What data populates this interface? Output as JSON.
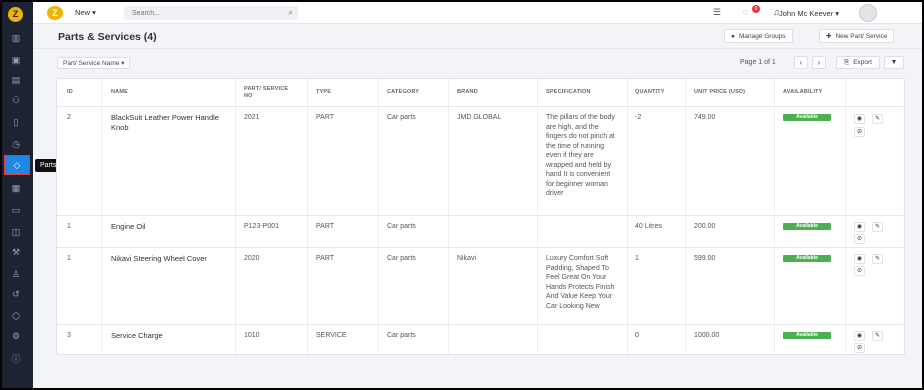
{
  "sidebar": {
    "logo_letter": "Z",
    "icons": [
      "dashboard-icon",
      "calendar-icon",
      "inventory-icon",
      "customers-icon",
      "map-icon",
      "history-icon",
      "parts-services-icon",
      "reports-icon",
      "folder-icon",
      "cube-icon",
      "tools-icon",
      "user-icon",
      "refresh-icon",
      "settings-icon",
      "gear-icon",
      "help-icon"
    ],
    "tooltip": "Parts & Services"
  },
  "topbar": {
    "logo_letter": "Z",
    "new_label": "New ▾",
    "search_placeholder": "Search...",
    "notification_count": "0",
    "user_name": "John Mc Keever ▾"
  },
  "header": {
    "title": "Parts & Services (4)",
    "manage_groups_label": "Manage Groups",
    "new_part_label": "New Part/ Service"
  },
  "toolbar": {
    "filter_label": "Part/ Service Name ▾",
    "pagination": "Page 1 of 1",
    "export_label": "Export"
  },
  "table": {
    "columns": [
      "ID",
      "NAME",
      "PART/ SERVICE NO",
      "TYPE",
      "CATEGORY",
      "BRAND",
      "SPECIFICATION",
      "QUANTITY",
      "UNIT PRICE (USD)",
      "AVAILABILITY"
    ],
    "rows": [
      {
        "id": "2",
        "name": "BlackSuit Leather Power Handle Knob",
        "part_no": "2021",
        "type": "PART",
        "category": "Car parts",
        "brand": "JMD GLOBAL",
        "specification": "The pillars of the body are high, and the fingers do not pinch at the time of running even if they are wrapped and held by hand It is convenient for beginner woman driver",
        "quantity": "-2",
        "unit_price": "749.00",
        "availability": "Available"
      },
      {
        "id": "1",
        "name": "Engine Oil",
        "part_no": "P123-P001",
        "type": "PART",
        "category": "Car parts",
        "brand": "",
        "specification": "",
        "quantity": "40 Litres",
        "unit_price": "200.00",
        "availability": "Available"
      },
      {
        "id": "1",
        "name": "Nikavi Steering Wheel Cover",
        "part_no": "2020",
        "type": "PART",
        "category": "Car parts",
        "brand": "Nikavi",
        "specification": "Luxury Comfort Soft Padding, Shaped To Feel Great On Your Hands Protects Finish And Value Keep Your Car Looking New",
        "quantity": "1",
        "unit_price": "599.00",
        "availability": "Available"
      },
      {
        "id": "3",
        "name": "Service Charge",
        "part_no": "1010",
        "type": "SERVICE",
        "category": "Car parts",
        "brand": "",
        "specification": "",
        "quantity": "0",
        "unit_price": "1000.00",
        "availability": "Available"
      }
    ]
  },
  "colors": {
    "accent": "#1e88e5",
    "available": "#4caf50",
    "sidebar": "#1d2331",
    "logo": "#f0b400"
  }
}
